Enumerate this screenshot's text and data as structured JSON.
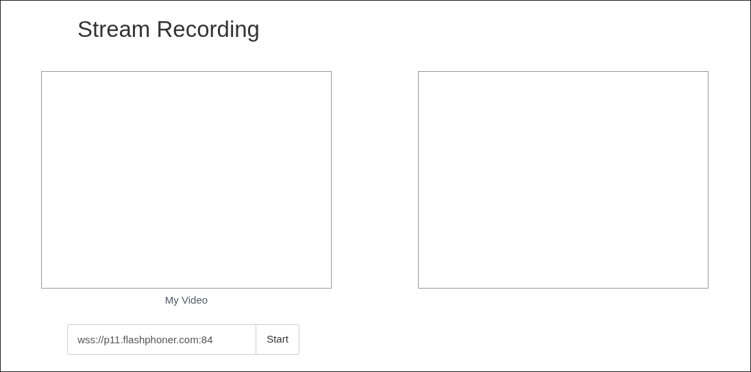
{
  "title": "Stream Recording",
  "local_video": {
    "caption": "My Video"
  },
  "connection": {
    "url": "wss://p11.flashphoner.com:84",
    "button": "Start"
  }
}
